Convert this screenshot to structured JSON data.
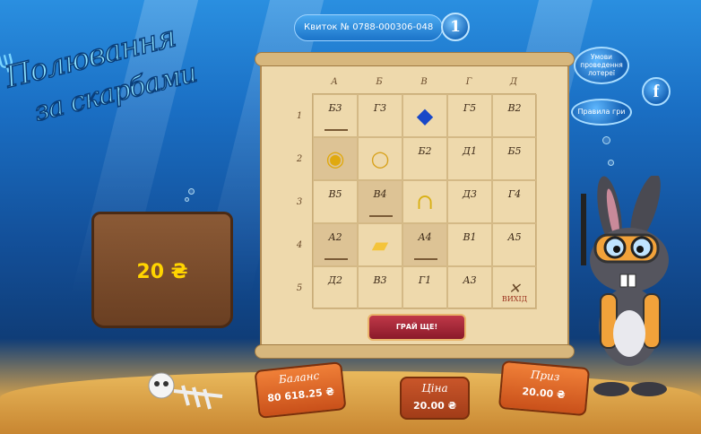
{
  "header": {
    "ticket_label": "Квиток №",
    "ticket_number": "0788-000306-048",
    "info_glyph": "1",
    "conditions_button": "Умови проведення лотереї",
    "rules_button": "Правила гри",
    "facebook_glyph": "f"
  },
  "logo": {
    "line1": "Полювання",
    "line2": "за скарбами"
  },
  "stone_value": "20 ₴",
  "board": {
    "columns": [
      "А",
      "Б",
      "В",
      "Г",
      "Д"
    ],
    "rows": [
      "1",
      "2",
      "3",
      "4",
      "5"
    ],
    "cells": [
      {
        "code": "Б3",
        "dark": false,
        "mountain": true
      },
      {
        "code": "Г3",
        "dark": false,
        "mountain": false
      },
      {
        "prize": "gem-icon",
        "dark": false
      },
      {
        "code": "Г5",
        "dark": false,
        "mountain": false
      },
      {
        "code": "В2",
        "dark": false,
        "mountain": false
      },
      {
        "prize": "coins-icon",
        "dark": true
      },
      {
        "prize": "ring-icon",
        "dark": false
      },
      {
        "code": "Б2",
        "dark": false,
        "mountain": false
      },
      {
        "code": "Д1",
        "dark": false,
        "mountain": false
      },
      {
        "code": "Б5",
        "dark": false,
        "mountain": false
      },
      {
        "code": "В5",
        "dark": false,
        "mountain": false
      },
      {
        "code": "В4",
        "dark": true,
        "mountain": true
      },
      {
        "prize": "horseshoe-icon",
        "dark": false
      },
      {
        "code": "Д3",
        "dark": false,
        "mountain": false
      },
      {
        "code": "Г4",
        "dark": false,
        "mountain": false
      },
      {
        "code": "А2",
        "dark": true,
        "mountain": true
      },
      {
        "prize": "gold-bar-icon",
        "dark": false
      },
      {
        "code": "А4",
        "dark": true,
        "mountain": true
      },
      {
        "code": "В1",
        "dark": false,
        "mountain": false
      },
      {
        "code": "А5",
        "dark": false,
        "mountain": false
      },
      {
        "code": "Д2",
        "dark": false,
        "mountain": false
      },
      {
        "code": "В3",
        "dark": false,
        "mountain": false
      },
      {
        "code": "Г1",
        "dark": false,
        "mountain": false
      },
      {
        "code": "А3",
        "dark": false,
        "mountain": false
      },
      {
        "exit": "ВИХІД",
        "dark": false
      }
    ]
  },
  "play_again": "ГРАЙ ЩЕ!",
  "balance": {
    "label": "Баланс",
    "value": "80 618.25 ₴"
  },
  "price": {
    "label": "Ціна",
    "value": "20.00 ₴"
  },
  "prize": {
    "label": "Приз",
    "value": "20.00 ₴"
  },
  "colors": {
    "accent": "#1b74c9",
    "panel": "#e0662a",
    "button": "#a52435"
  }
}
